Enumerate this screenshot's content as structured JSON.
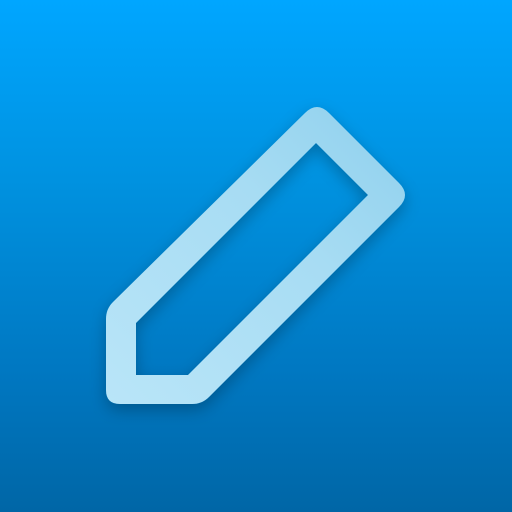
{
  "icon": {
    "name": "pencil-icon",
    "tile_color_top": "#00a6ff",
    "tile_color_bottom": "#0066a6",
    "pencil_color_light": "#b9e5f8",
    "pencil_color_mid": "#98d5ef"
  }
}
